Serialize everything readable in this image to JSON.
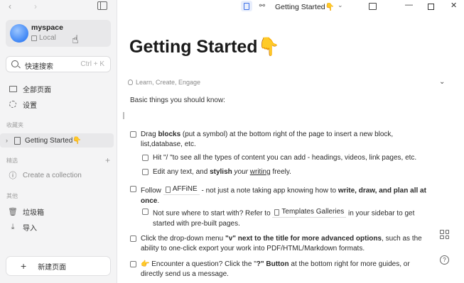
{
  "sidebar": {
    "nav_back": "‹",
    "nav_forward": "›",
    "workspace": {
      "name": "myspace",
      "type": "Local"
    },
    "search": {
      "label": "快速搜索",
      "shortcut": "Ctrl + K"
    },
    "items": [
      {
        "label": "全部页面",
        "icon": "folder-icon"
      },
      {
        "label": "设置",
        "icon": "gear-icon"
      }
    ],
    "favorites_label": "收藏夹",
    "favorite_page": "Getting Started👇",
    "collections_label": "精选",
    "create_collection": "Create a collection",
    "others_label": "其他",
    "others": [
      {
        "label": "垃圾箱",
        "icon": "trash-icon"
      },
      {
        "label": "导入",
        "icon": "import-icon"
      }
    ],
    "new_page": "新建页面"
  },
  "topbar": {
    "doc_title": "Getting Started👇",
    "chevron": "⌄",
    "minimize": "—",
    "close": "✕"
  },
  "main": {
    "title": "Getting Started👇",
    "meta": "Learn, Create, Engage",
    "intro": "Basic things you should know:",
    "todos": {
      "t1_a": "Drag ",
      "t1_b": "blocks",
      "t1_c": " (put a symbol) at the bottom right of the page to insert a new block,",
      "t1_d": "list,database, etc.",
      "t2": "Hit \"/ \"to see all the types of content you can add - headings, videos, link pages, etc.",
      "t3_a": "Edit any text, and ",
      "t3_b": "stylish",
      "t3_c": "your",
      "t3_d": "writing",
      "t3_e": " freely.",
      "t4_a": "Follow ",
      "t4_chip": "AFFiNE",
      "t4_b": " - not just a note taking app  knowing how to ",
      "t4_c": "write, draw, and plan all at",
      "t4_d": "once",
      "t4_e": ".",
      "t5_a": "Not sure where to start with? Refer to ",
      "t5_chip": "Templates Galleries",
      "t5_b": " in your sidebar to get",
      "t5_c": "started with pre-built pages.",
      "t6_a": "Click the drop-down menu ",
      "t6_b": "\"v\" next to the title for more advanced options",
      "t6_c": ", such as the",
      "t6_d": "ability to one-click export your work into PDF/HTML/Markdown formats.",
      "t7_a": "👉 Encounter a question?  Click the \"",
      "t7_b": "?\" Button",
      "t7_c": " at the bottom right for more guides, or",
      "t7_d": "directly send us a message."
    },
    "help": "?"
  }
}
